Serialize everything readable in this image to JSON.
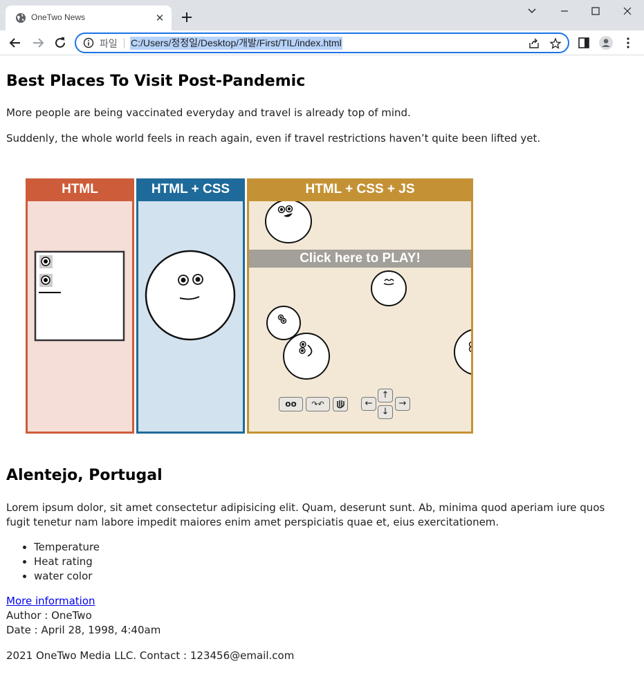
{
  "browser": {
    "tab_title": "OneTwo News",
    "scheme_label": "파일",
    "url": "C:/Users/정정일/Desktop/개발/First/TIL/index.html",
    "colors": {
      "tabbar": "#dee1e6",
      "omnibox_border": "#1a73e8",
      "url_selection": "#b7d3f9"
    }
  },
  "article": {
    "heading": "Best Places To Visit Post-Pandemic",
    "paragraph1": "More people are being vaccinated everyday and travel is already top of mind.",
    "paragraph2": "Suddenly, the whole world feels in reach again, even if travel restrictions haven’t quite been lifted yet.",
    "illustration": {
      "panel_html": {
        "label": "HTML",
        "color": "#cd5c3a",
        "bg": "#f5ded8"
      },
      "panel_css": {
        "label": "HTML + CSS",
        "color": "#1e6a9a",
        "bg": "#d2e2ef"
      },
      "panel_js": {
        "label": "HTML + CSS + JS",
        "color": "#c49235",
        "bg": "#f3e8d6",
        "banner": "Click here to PLAY!"
      },
      "controls": {
        "btn1": "oo",
        "btn2": "↷↶",
        "up": "↑",
        "left": "←",
        "right": "→",
        "down": "↓"
      }
    },
    "section_heading": "Alentejo, Portugal",
    "lorem": "Lorem ipsum dolor, sit amet consectetur adipisicing elit. Quam, deserunt sunt. Ab, minima quod aperiam iure quos fugit tenetur nam labore impedit maiores enim amet perspiciatis quae et, eius exercitationem.",
    "features": [
      "Temperature",
      "Heat rating",
      "water color"
    ],
    "more_link": "More information",
    "author": "Author : OneTwo",
    "date": "Date : April 28, 1998, 4:40am",
    "footer": "2021 OneTwo Media LLC. Contact : 123456@email.com"
  }
}
